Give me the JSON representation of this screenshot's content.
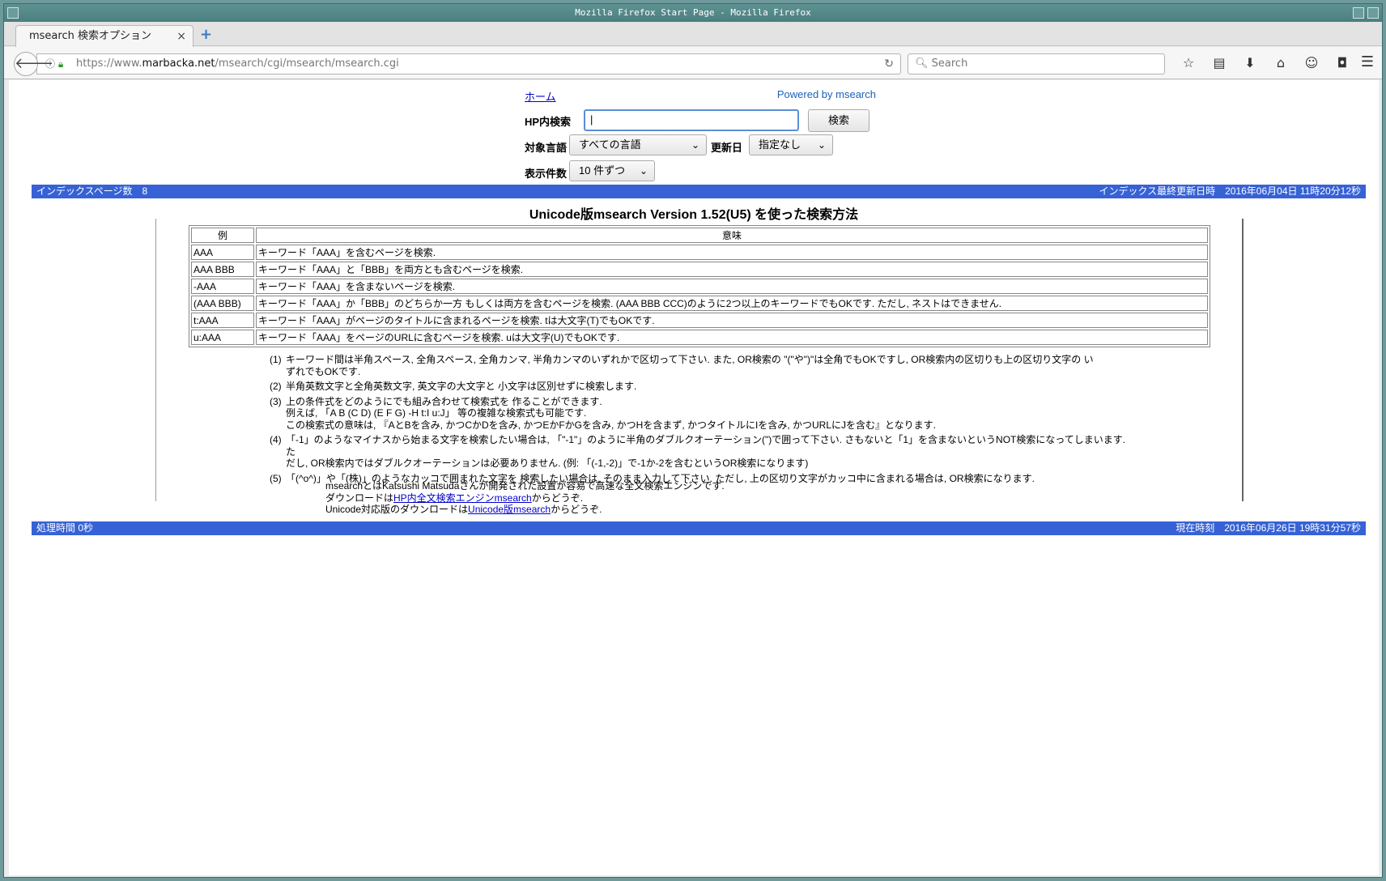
{
  "window": {
    "title": "Mozilla Firefox Start Page - Mozilla Firefox"
  },
  "tab": {
    "label": "msearch 検索オプション",
    "close": "×",
    "new_tab": "+"
  },
  "nav": {
    "url_prefix": "https://www.",
    "url_host": "marbacka.net",
    "url_path": "/msearch/cgi/msearch/msearch.cgi",
    "search_placeholder": "Search"
  },
  "form": {
    "home_link": "ホーム",
    "powered_by": "Powered by msearch",
    "query_label": "HP内検索",
    "query_value": "",
    "search_button": "検索",
    "lang_label": "対象言語",
    "lang_value": "すべての言語",
    "date_label": "更新日",
    "date_value": "指定なし",
    "count_label": "表示件数",
    "count_value": "10 件ずつ"
  },
  "top_bar": {
    "left": "インデックスページ数　8",
    "right": "インデックス最終更新日時　2016年06月04日 11時20分12秒"
  },
  "help": {
    "title": "Unicode版msearch  Version 1.52(U5) を使った検索方法",
    "table_headers": [
      "例",
      "意味"
    ],
    "rows": [
      {
        "example": "AAA",
        "meaning": "キーワード「AAA」を含むページを検索."
      },
      {
        "example": "AAA BBB",
        "meaning": "キーワード「AAA」と「BBB」を両方とも含むページを検索."
      },
      {
        "example": "-AAA",
        "meaning": "キーワード「AAA」を含まないページを検索."
      },
      {
        "example": "(AAA BBB)",
        "meaning": "キーワード「AAA」か「BBB」のどちらか一方 もしくは両方を含むページを検索. (AAA BBB CCC)のように2つ以上のキーワードでもOKです. ただし, ネストはできません."
      },
      {
        "example": "t:AAA",
        "meaning": "キーワード「AAA」がページのタイトルに含まれるページを検索. tは大文字(T)でもOKです."
      },
      {
        "example": "u:AAA",
        "meaning": "キーワード「AAA」をページのURLに含むページを検索. uは大文字(U)でもOKです."
      }
    ],
    "notes": [
      {
        "num": "(1)",
        "lines": [
          "キーワード間は半角スペース, 全角スペース, 全角カンマ, 半角カンマのいずれかで区切って下さい. また, OR検索の \"(\"や\")\"は全角でもOKですし, OR検索内の区切りも上の区切り文字の い",
          "ずれでもOKです."
        ]
      },
      {
        "num": "(2)",
        "lines": [
          "半角英数文字と全角英数文字, 英文字の大文字と 小文字は区別せずに検索します."
        ]
      },
      {
        "num": "(3)",
        "lines": [
          "上の条件式をどのようにでも組み合わせて検索式を 作ることができます.",
          "例えば, 「A B (C D) (E F G) -H t:I u:J」 等の複雑な検索式も可能です.",
          "この検索式の意味は, 『AとBを含み, かつCかDを含み, かつEかFかGを含み, かつHを含まず, かつタイトルにIを含み, かつURLにJを含む』となります."
        ]
      },
      {
        "num": "(4)",
        "lines": [
          "「-1」のようなマイナスから始まる文字を検索したい場合は, 「\"-1\"」のように半角のダブルクオーテーション(\")で囲って下さい. さもないと「1」を含まないというNOT検索になってしまいます. た",
          "だし, OR検索内ではダブルクオーテーションは必要ありません. (例: 「(-1,-2)」で-1か-2を含むというOR検索になります)"
        ]
      },
      {
        "num": "(5)",
        "lines": [
          "「(^o^)」や「(株)」のようなカッコで囲まれた文字を 検索したい場合は, そのまま入力して下さい. ただし, 上の区切り文字がカッコ中に含まれる場合は, OR検索になります."
        ]
      }
    ]
  },
  "about": {
    "line1": "msearchとはKatsushi Matsudaさんが開発された設置が容易で高速な全文検索エンジンです.",
    "line2_pre": "ダウンロードは",
    "line2_link": "HP内全文検索エンジンmsearch",
    "line2_post": "からどうぞ.",
    "line3_pre": "Unicode対応版のダウンロードは",
    "line3_link": "Unicode版msearch",
    "line3_post": "からどうぞ."
  },
  "bottom_bar": {
    "left": "処理時間 0秒",
    "right": "現在時刻　2016年06月26日 19時31分57秒"
  }
}
